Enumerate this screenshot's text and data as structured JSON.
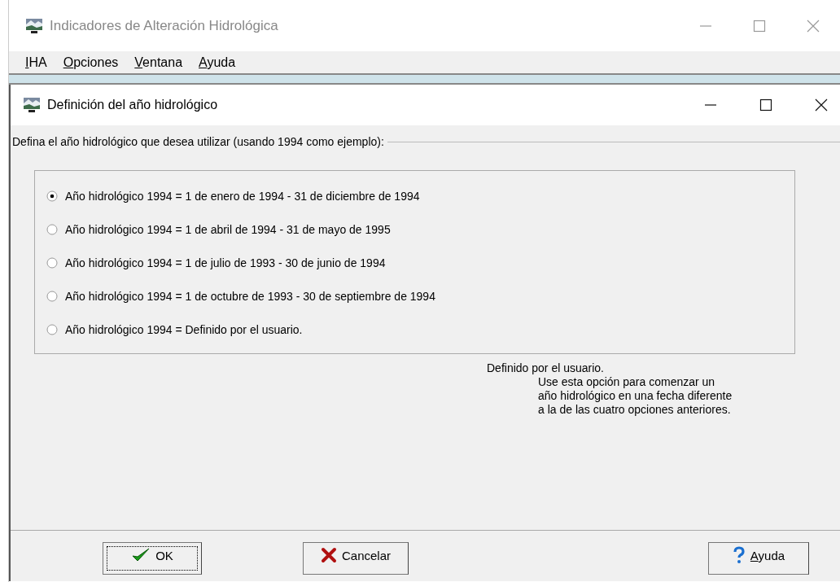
{
  "main_window": {
    "title": "Indicadores de Alteración Hidrológica",
    "active": false
  },
  "menu": [
    {
      "label": "IHA"
    },
    {
      "label": "Opciones"
    },
    {
      "label": "Ventana"
    },
    {
      "label": "Ayuda"
    }
  ],
  "dialog": {
    "title": "Definición del año hidrológico",
    "active": true,
    "group_label": "Defina el año hidrológico que desea utilizar (usando 1994 como ejemplo):",
    "options": [
      {
        "label": "Año hidrológico 1994 = 1 de enero de 1994 - 31 de diciembre de 1994",
        "selected": true
      },
      {
        "label": "Año hidrológico 1994 = 1 de abril de 1994 - 31 de mayo de 1995",
        "selected": false
      },
      {
        "label": "Año hidrológico 1994 = 1 de julio de 1993 - 30 de junio de 1994",
        "selected": false
      },
      {
        "label": "Año hidrológico 1994 = 1 de octubre de 1993 - 30 de septiembre de 1994",
        "selected": false
      },
      {
        "label": "Año hidrológico 1994 = Definido por el usuario.",
        "selected": false
      }
    ],
    "description": {
      "heading": "Definido por el usuario.",
      "body_lines": [
        "Use esta opción para comenzar un",
        "año hidrológico en una fecha diferente",
        "a la de las cuatro opciones anteriores."
      ]
    },
    "buttons": [
      {
        "label": "OK",
        "kind": "ok",
        "focused": true
      },
      {
        "label": "Cancelar",
        "kind": "cancel",
        "focused": false
      },
      {
        "label": "Ayuda",
        "kind": "help",
        "focused": false
      }
    ]
  }
}
